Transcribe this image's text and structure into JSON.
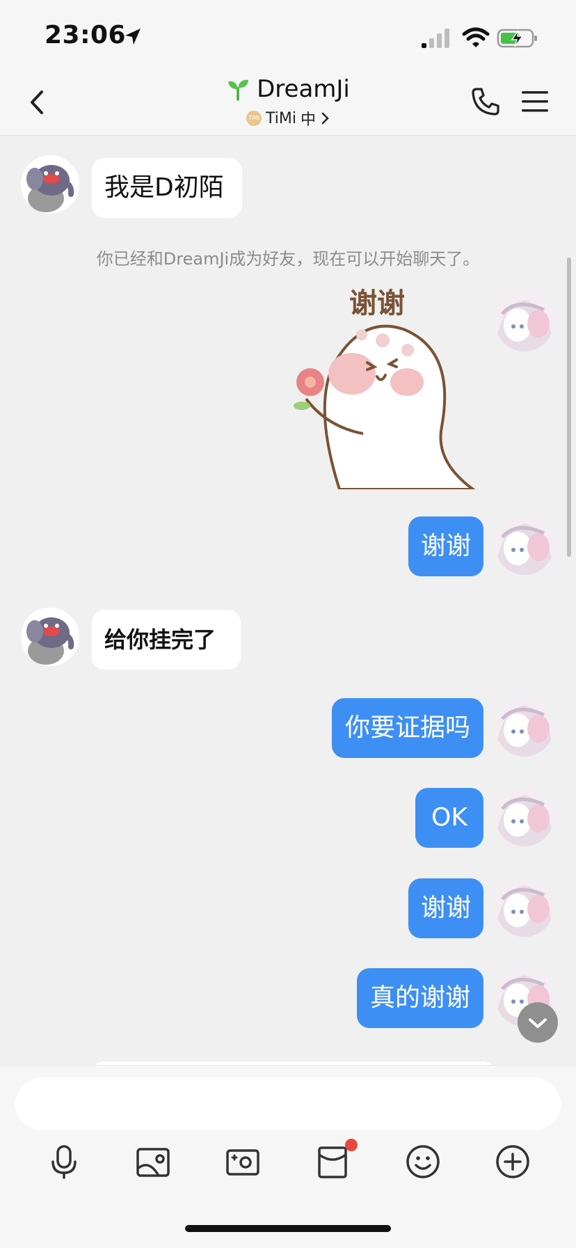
{
  "status": {
    "time": "23:06"
  },
  "header": {
    "back_icon": "chevron-left-icon",
    "title": "DreamJi",
    "subtitle_app": "TiMi",
    "subtitle_status": "中",
    "call_icon": "phone-icon",
    "menu_icon": "menu-icon"
  },
  "chat": {
    "system_message": "你已经和DreamJi成为好友，现在可以开始聊天了。",
    "messages": [
      {
        "from": "them",
        "text": "我是D初陌"
      },
      {
        "from": "me",
        "type": "sticker",
        "text": "谢谢"
      },
      {
        "from": "me",
        "text": "谢谢"
      },
      {
        "from": "them",
        "text": "给你挂完了"
      },
      {
        "from": "me",
        "text": "你要证据吗"
      },
      {
        "from": "me",
        "text": "OK"
      },
      {
        "from": "me",
        "text": "谢谢"
      },
      {
        "from": "me",
        "text": "真的谢谢"
      }
    ]
  },
  "composer": {
    "placeholder": ""
  },
  "toolbar": {
    "icons": [
      "microphone-icon",
      "photo-icon",
      "camera-icon",
      "red-packet-icon",
      "emoji-icon",
      "plus-icon"
    ]
  },
  "colors": {
    "outgoing_bubble": "#3d8ff4",
    "incoming_bubble": "#ffffff",
    "background": "#f0f0f0",
    "badge": "#e8473b"
  }
}
